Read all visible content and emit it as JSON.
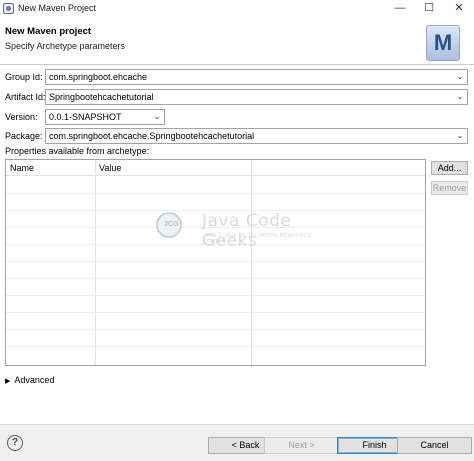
{
  "window": {
    "title": "New Maven Project",
    "minimize_glyph": "—",
    "maximize_glyph": "☐",
    "close_glyph": "✕"
  },
  "header": {
    "title": "New Maven project",
    "subtitle": "Specify Archetype parameters",
    "logo_letter": "M"
  },
  "form": {
    "group_id": {
      "label": "Group Id:",
      "value": "com.springboot.ehcache"
    },
    "artifact_id": {
      "label": "Artifact Id:",
      "value": "Springbootehcachetutorial"
    },
    "version": {
      "label": "Version:",
      "value": "0.0.1-SNAPSHOT"
    },
    "package": {
      "label": "Package:",
      "value": "com.springboot.ehcache.Springbootehcachetutorial"
    }
  },
  "properties": {
    "label": "Properties available from archetype:",
    "columns": [
      "Name",
      "Value"
    ],
    "add_button": "Add...",
    "remove_button": "Remove"
  },
  "watermark": {
    "text": "Java Code Geeks",
    "subtext": "JAVA 2 JAVA DEVELOPERS RESOURCE CENTER",
    "badge": "JCG"
  },
  "advanced": {
    "label": "Advanced",
    "glyph": "▶"
  },
  "footer": {
    "help_glyph": "?",
    "back_label": "< Back",
    "next_label": "Next >",
    "finish_label": "Finish",
    "cancel_label": "Cancel"
  }
}
